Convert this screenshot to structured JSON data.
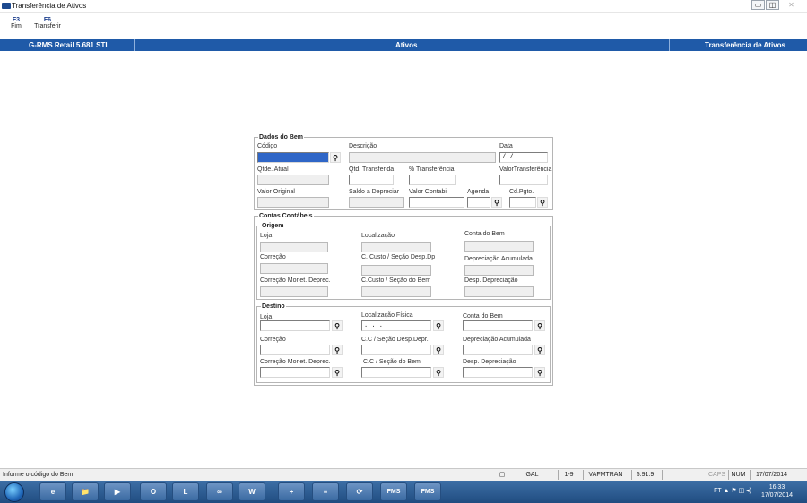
{
  "window": {
    "title": "Transferência de Ativos",
    "minimize": "▭",
    "maximize": "◫",
    "close": "✕"
  },
  "fkeys": [
    {
      "key": "F3",
      "label": "Fim"
    },
    {
      "key": "F6",
      "label": "Transferir"
    }
  ],
  "header": {
    "app": "G-RMS Retail 5.681 STL",
    "module": "Ativos",
    "screen": "Transferência de Ativos"
  },
  "dados_bem": {
    "legend": "Dados do Bem",
    "codigo": "Código",
    "descricao": "Descrição",
    "data": "Data",
    "data_value": " / /",
    "qtde_atual": "Qtde. Atual",
    "qtd_transferida": "Qtd. Transferida",
    "pct_transferencia": "% Transferência",
    "valor_transferencia": "ValorTransferência",
    "valor_original": "Valor Original",
    "saldo_depreciar": "Saldo a Depreciar",
    "valor_contabil": "Valor Contabil",
    "agenda": "Agenda",
    "cd_pgto": "Cd.Pgto."
  },
  "contas": {
    "legend": "Contas Contábeis"
  },
  "origem": {
    "legend": "Origem",
    "loja": "Loja",
    "localizacao": "Localização",
    "conta_bem": "Conta do Bem",
    "correcao": "Correção",
    "ccusto_desp": "C. Custo / Seção Desp.Dp",
    "dep_acumulada": "Depreciação Acumulada",
    "correcao_monet": "Correção Monet. Deprec.",
    "ccusto_bem": "C.Custo / Seção do Bem",
    "desp_depreciacao": "Desp. Depreciação"
  },
  "destino": {
    "legend": "Destino",
    "loja": "Loja",
    "localizacao": "Localização Física",
    "localizacao_value": " .  .  .",
    "conta_bem": "Conta do Bem",
    "correcao": "Correção",
    "ccusto_desp": "C.C / Seção Desp.Depr.",
    "dep_acumulada": "Depreciação Acumulada",
    "correcao_monet": "Correção Monet. Deprec.",
    "ccusto_bem": "C.C / Seção do Bem",
    "desp_depreciacao": "Desp. Depreciação"
  },
  "statusbar": {
    "message": "Informe o código do Bem",
    "cells": [
      "GAL",
      "1-9",
      "VAFMTRAN",
      "5.91.9",
      "",
      "CAPS",
      "NUM",
      "17/07/2014"
    ]
  },
  "taskbar": {
    "apps": [
      "e",
      "📁",
      "▶",
      "O",
      "L",
      "∞",
      "W",
      "+",
      "≡",
      "⟳",
      "FMS",
      "FMS"
    ],
    "tray": "FT  ▲  ⚑  ◫  ◂)",
    "time": "16:33",
    "date": "17/07/2014"
  },
  "colors": {
    "header_bg": "#1f5aa8",
    "selected_field": "#2f66c7",
    "taskbar": "#204c80"
  }
}
